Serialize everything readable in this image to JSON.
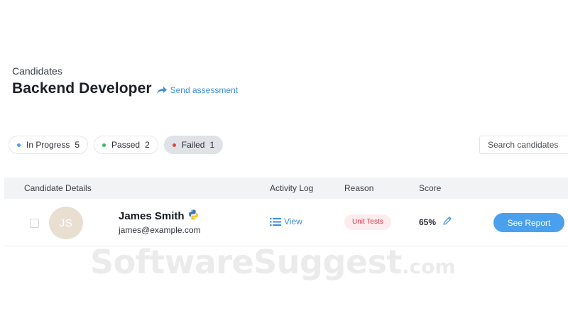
{
  "header": {
    "breadcrumb": "Candidates",
    "title": "Backend Developer",
    "send_assessment": "Send assessment",
    "send_icon": "share-arrow-icon"
  },
  "filters": [
    {
      "label": "In Progress",
      "count": "5",
      "dot_color": "#4a9fe8",
      "active": false
    },
    {
      "label": "Passed",
      "count": "2",
      "dot_color": "#3fb560",
      "active": false
    },
    {
      "label": "Failed",
      "count": "1",
      "dot_color": "#e2473d",
      "active": true
    }
  ],
  "search": {
    "placeholder": "Search candidates"
  },
  "table": {
    "columns": [
      "Candidate Details",
      "Activity Log",
      "Reason",
      "Score"
    ],
    "rows": [
      {
        "initials": "JS",
        "name": "James Smith",
        "name_icon": "python-logo-icon",
        "email": "james@example.com",
        "activity_label": "View",
        "activity_icon": "list-icon",
        "reason": "Unit Tests",
        "score": "65%",
        "edit_icon": "pencil-icon",
        "action_label": "See Report"
      }
    ]
  },
  "watermark": {
    "main": "SoftwareSuggest",
    "tld": ".com"
  },
  "colors": {
    "accent": "#4aa0ec",
    "link": "#3b8fd9",
    "fail_badge_bg": "#fdecee",
    "fail_badge_text": "#d9394a"
  }
}
